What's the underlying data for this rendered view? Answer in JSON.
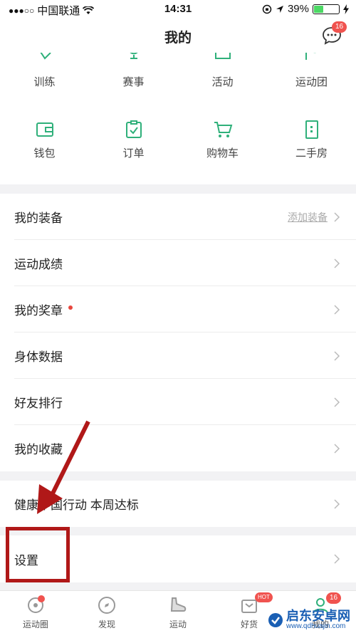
{
  "status_bar": {
    "signal": "●●●○○",
    "carrier": "中国联通",
    "time": "14:31",
    "battery": "39%",
    "battery_level": 0.39
  },
  "nav": {
    "title": "我的",
    "message_badge": "16"
  },
  "grid": {
    "row1": [
      {
        "label": "训练",
        "icon": "training-icon"
      },
      {
        "label": "赛事",
        "icon": "trophy-icon"
      },
      {
        "label": "活动",
        "icon": "activity-icon"
      },
      {
        "label": "运动团",
        "icon": "flag-icon"
      }
    ],
    "row2": [
      {
        "label": "钱包",
        "icon": "wallet-icon"
      },
      {
        "label": "订单",
        "icon": "order-icon"
      },
      {
        "label": "购物车",
        "icon": "cart-icon"
      },
      {
        "label": "二手房",
        "icon": "door-icon"
      }
    ]
  },
  "list": {
    "equipment": {
      "label": "我的装备",
      "extra": "添加装备"
    },
    "results": {
      "label": "运动成绩"
    },
    "medals": {
      "label": "我的奖章"
    },
    "body_data": {
      "label": "身体数据"
    },
    "friends_rank": {
      "label": "好友排行"
    },
    "favorites": {
      "label": "我的收藏"
    },
    "health": {
      "label": "健康中国行动 本周达标"
    },
    "settings": {
      "label": "设置"
    }
  },
  "tabs": [
    {
      "label": "运动圈",
      "icon": "circle-feed-icon"
    },
    {
      "label": "发现",
      "icon": "compass-icon"
    },
    {
      "label": "运动",
      "icon": "shoe-icon"
    },
    {
      "label": "好货",
      "icon": "shop-icon",
      "badge": "HOT"
    },
    {
      "label": "我的",
      "icon": "profile-icon",
      "badge": "16"
    }
  ],
  "watermark": {
    "title": "启东安卓网",
    "url": "www.qdhuajin.com"
  },
  "colors": {
    "accent_green": "#2fb07a",
    "badge_red": "#f0534f",
    "annotation_red": "#b01818",
    "background": "#f2f2f4"
  }
}
